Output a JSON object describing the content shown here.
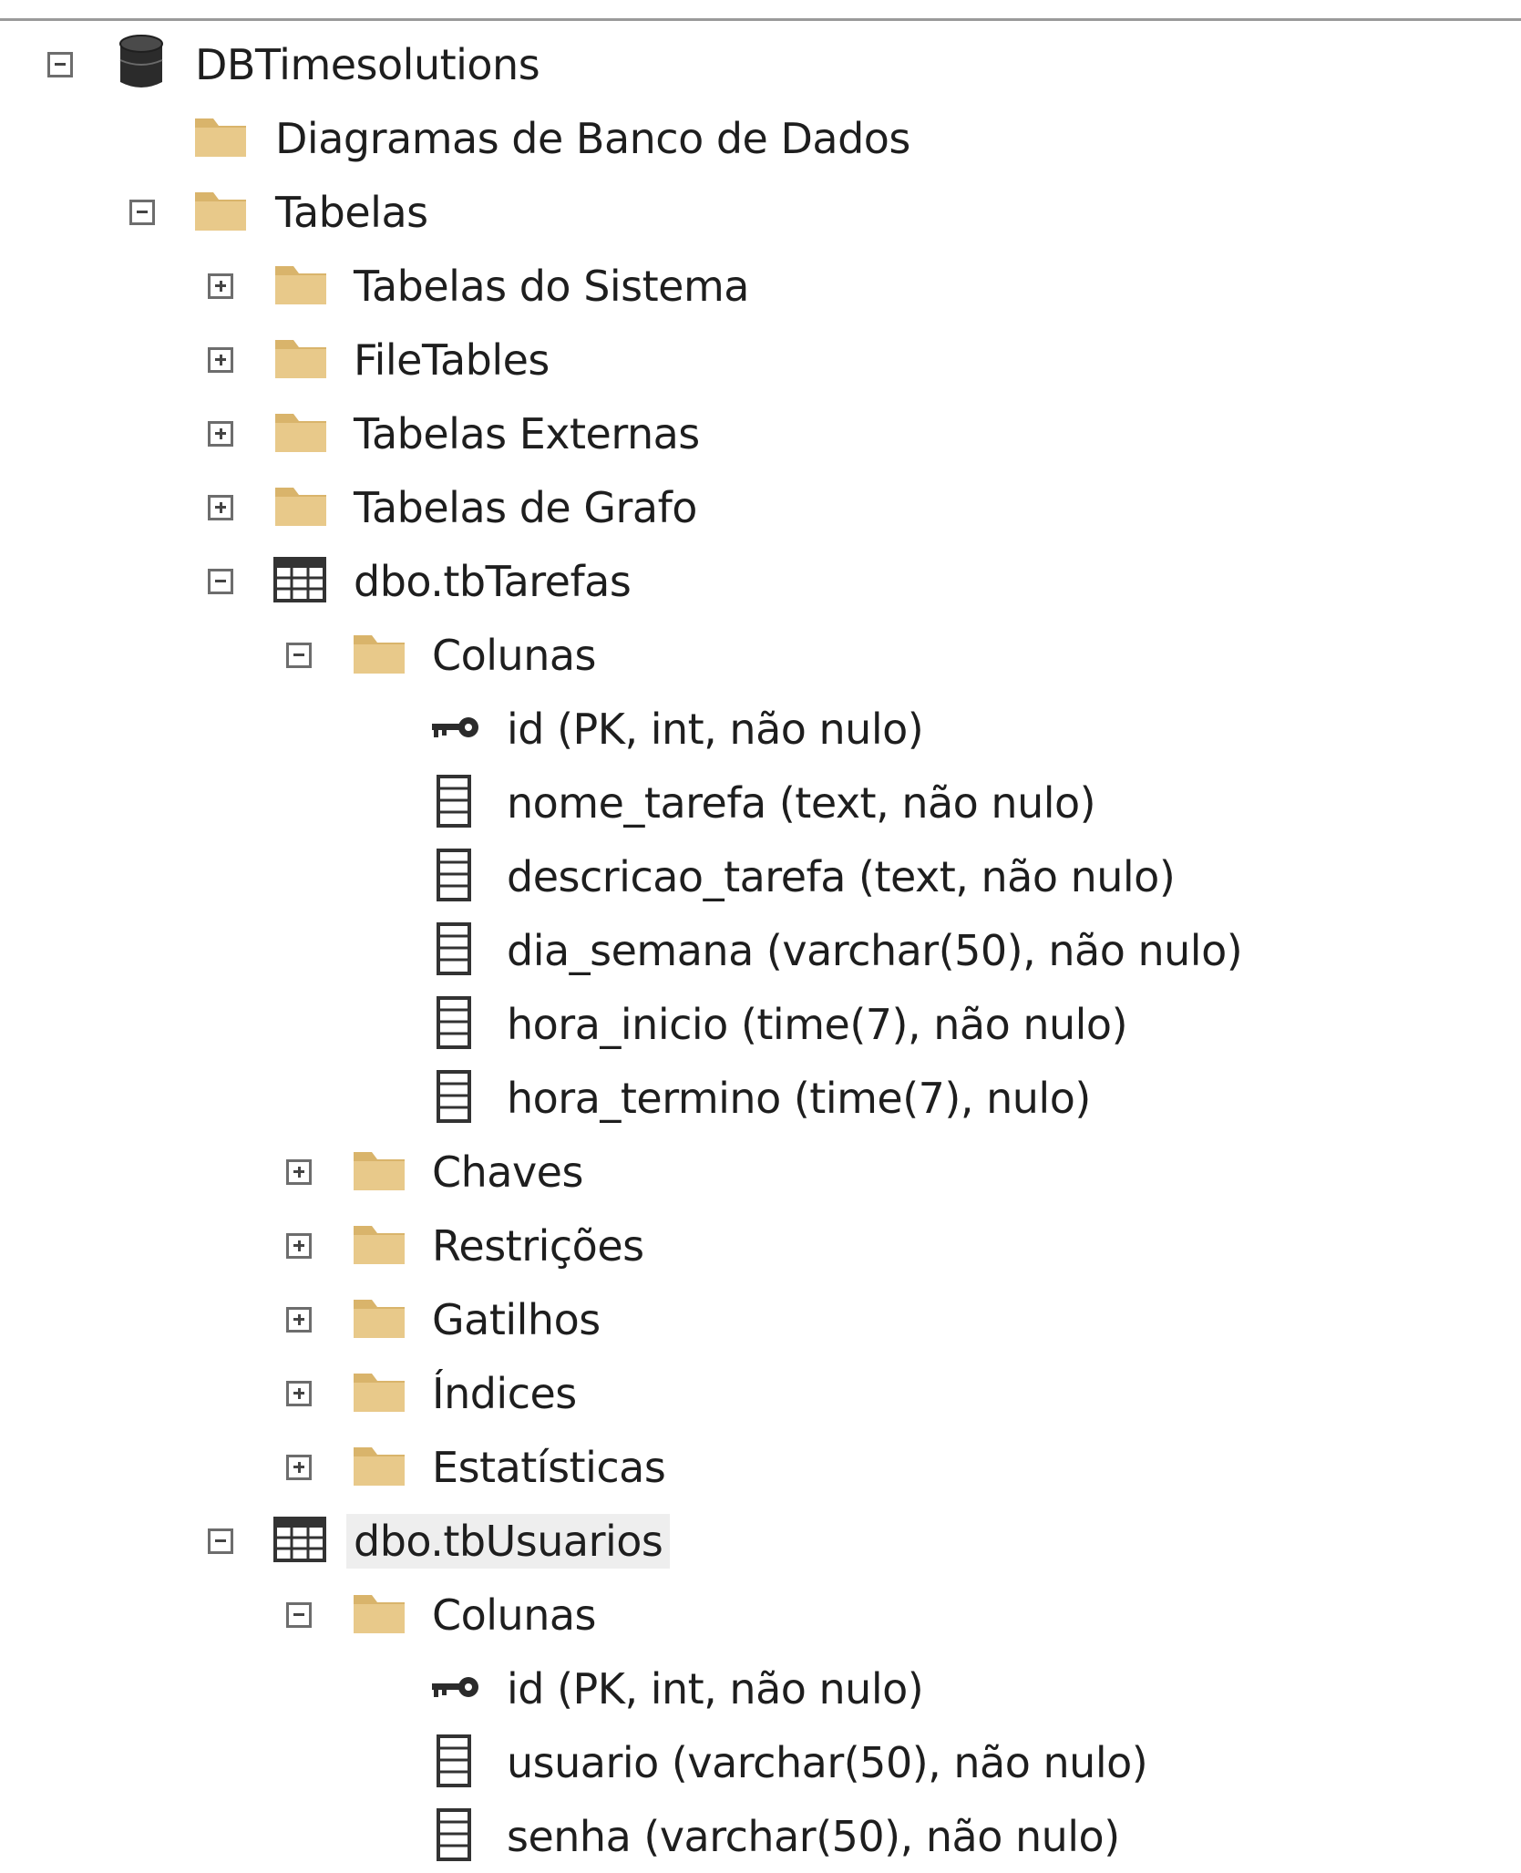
{
  "tree": {
    "root": {
      "label": "DBTimesolutions",
      "icon": "database-icon",
      "state": "expanded"
    },
    "diagramas": {
      "label": "Diagramas de Banco de Dados",
      "icon": "folder-icon"
    },
    "tabelas": {
      "label": "Tabelas",
      "icon": "folder-icon",
      "state": "expanded"
    },
    "tabelas_sistema": {
      "label": "Tabelas do Sistema",
      "icon": "folder-icon",
      "state": "collapsed"
    },
    "filetables": {
      "label": "FileTables",
      "icon": "folder-icon",
      "state": "collapsed"
    },
    "tabelas_externas": {
      "label": "Tabelas Externas",
      "icon": "folder-icon",
      "state": "collapsed"
    },
    "tabelas_grafo": {
      "label": "Tabelas de Grafo",
      "icon": "folder-icon",
      "state": "collapsed"
    },
    "tbTarefas": {
      "label": "dbo.tbTarefas",
      "icon": "table-icon",
      "state": "expanded",
      "colunas": {
        "label": "Colunas",
        "icon": "folder-icon",
        "state": "expanded",
        "items": [
          {
            "label": "id (PK, int, não nulo)",
            "icon": "key-icon"
          },
          {
            "label": "nome_tarefa (text, não nulo)",
            "icon": "column-icon"
          },
          {
            "label": "descricao_tarefa (text, não nulo)",
            "icon": "column-icon"
          },
          {
            "label": "dia_semana (varchar(50), não nulo)",
            "icon": "column-icon"
          },
          {
            "label": "hora_inicio (time(7), não nulo)",
            "icon": "column-icon"
          },
          {
            "label": "hora_termino (time(7), nulo)",
            "icon": "column-icon"
          }
        ]
      },
      "chaves": {
        "label": "Chaves",
        "icon": "folder-icon",
        "state": "collapsed"
      },
      "restricoes": {
        "label": "Restrições",
        "icon": "folder-icon",
        "state": "collapsed"
      },
      "gatilhos": {
        "label": "Gatilhos",
        "icon": "folder-icon",
        "state": "collapsed"
      },
      "indices": {
        "label": "Índices",
        "icon": "folder-icon",
        "state": "collapsed"
      },
      "estatisticas": {
        "label": "Estatísticas",
        "icon": "folder-icon",
        "state": "collapsed"
      }
    },
    "tbUsuarios": {
      "label": "dbo.tbUsuarios",
      "icon": "table-icon",
      "state": "expanded",
      "selected": true,
      "colunas": {
        "label": "Colunas",
        "icon": "folder-icon",
        "state": "expanded",
        "items": [
          {
            "label": "id (PK, int, não nulo)",
            "icon": "key-icon"
          },
          {
            "label": "usuario (varchar(50), não nulo)",
            "icon": "column-icon"
          },
          {
            "label": "senha (varchar(50), não nulo)",
            "icon": "column-icon"
          }
        ]
      }
    }
  },
  "colors": {
    "folder": "#d9b46b",
    "folder_light": "#e8c98a",
    "icon_dark": "#333333",
    "expander_border": "#6d6d6d",
    "selected_bg": "#eeeeee"
  }
}
